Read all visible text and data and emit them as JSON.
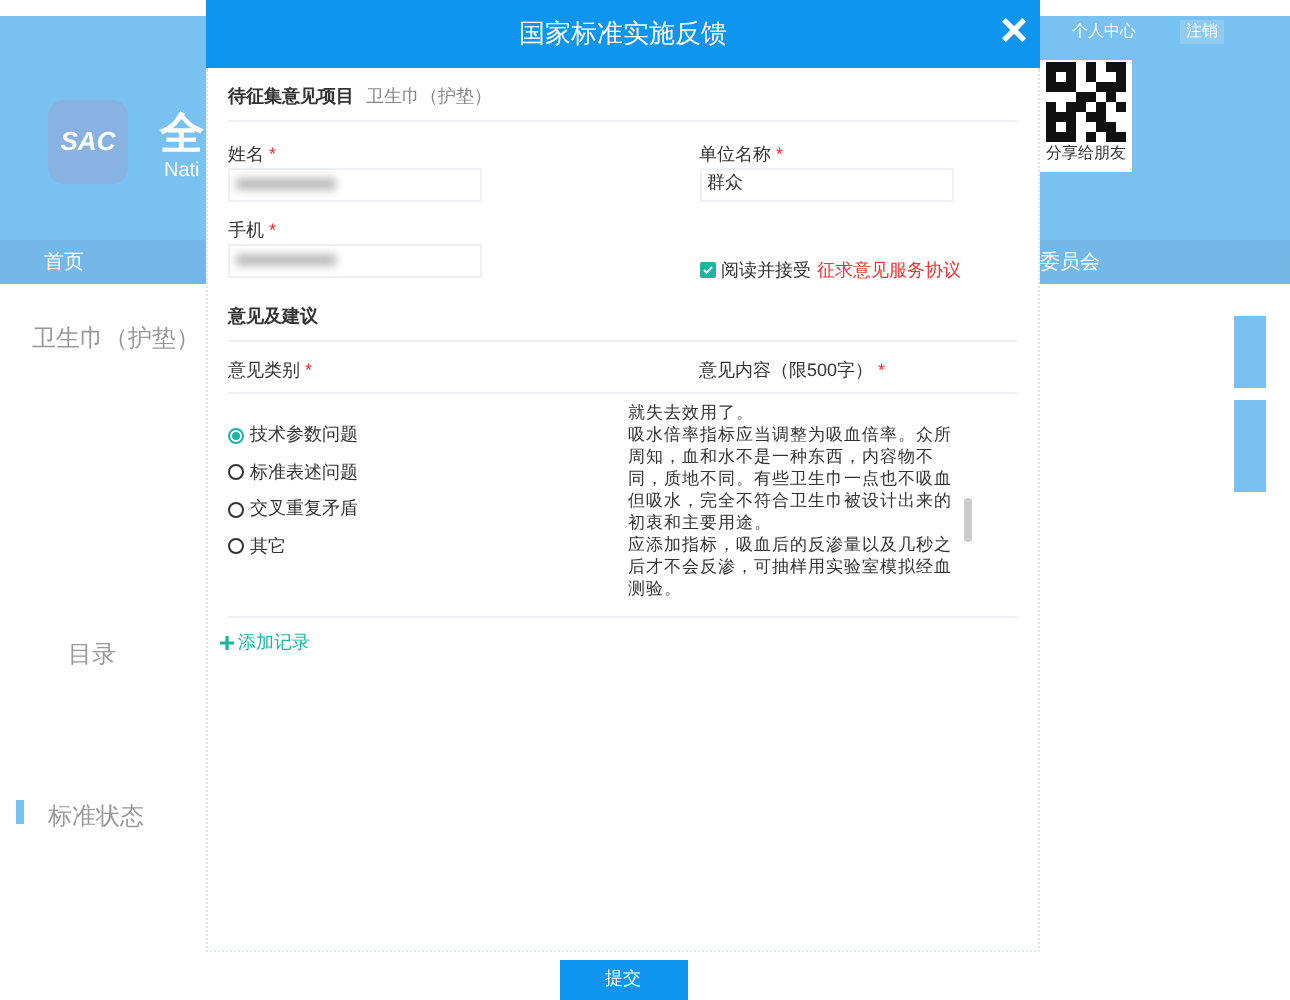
{
  "background": {
    "logo": "SAC",
    "site_initial": "全",
    "site_subtitle": "Nati",
    "top_links": [
      "个人中心",
      "注销"
    ],
    "qr_caption": "分享给朋友",
    "nav": [
      "首页"
    ],
    "nav_right": "委员会",
    "title": "卫生巾（护垫）",
    "toc_label": "目录",
    "section": "标准状态"
  },
  "dialog": {
    "title": "国家标准实施反馈",
    "close": "×",
    "project_label": "待征集意见项目",
    "project_value": "卫生巾（护垫）",
    "fields": [
      {
        "label": "姓名",
        "required": "*",
        "redacted": true
      },
      {
        "label": "单位名称",
        "required": "*",
        "value": "群众",
        "redacted": false
      },
      {
        "label": "手机",
        "required": "*",
        "redacted": true
      }
    ],
    "agreement": {
      "checked": true,
      "text": "阅读并接受",
      "link": "征求意见服务协议"
    },
    "section": "意见及建议",
    "category_label": "意见类别",
    "category_required": "*",
    "content_label": "意见内容（限500字）",
    "content_required": "*",
    "categories": [
      {
        "label": "技术参数问题",
        "selected": true
      },
      {
        "label": "标准表述问题",
        "selected": false
      },
      {
        "label": "交叉重复矛盾",
        "selected": false
      },
      {
        "label": "其它",
        "selected": false
      }
    ],
    "content": [
      "就失去效用了。",
      "吸水倍率指标应当调整为吸血倍率。众所周知，血和水不是一种东西，内容物不同，质地不同。有些卫生巾一点也不吸血但吸水，完全不符合卫生巾被设计出来的初衷和主要用途。",
      "应添加指标，吸血后的反渗量以及几秒之后才不会反渗，可抽样用实验室模拟经血测验。"
    ],
    "add_record": "添加记录",
    "submit": "提交"
  }
}
